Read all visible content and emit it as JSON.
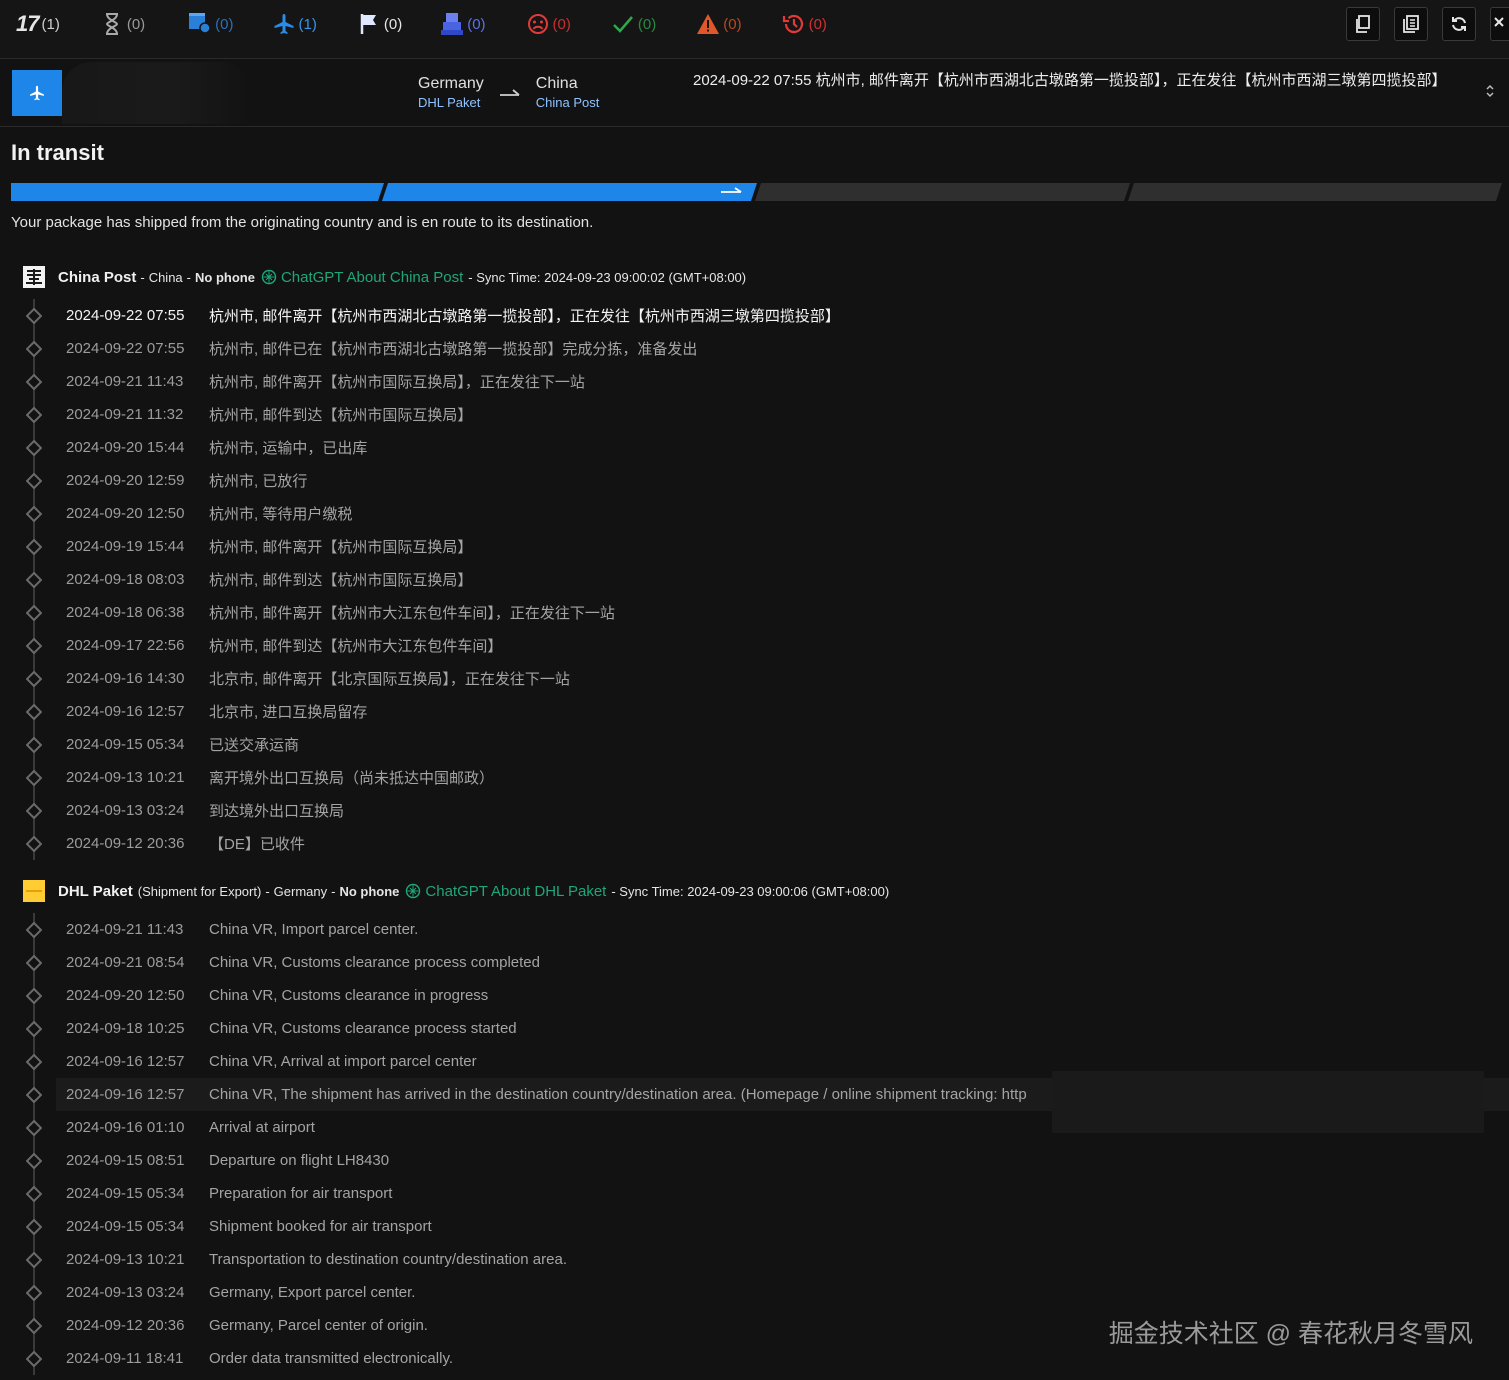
{
  "filters": [
    {
      "name": "all-filter",
      "icon": "brand-17-logo",
      "count": "(1)"
    },
    {
      "name": "pending-filter",
      "icon": "hourglass-icon",
      "count": "(0)"
    },
    {
      "name": "info-received-filter",
      "icon": "truck-box-icon",
      "count": "(0)"
    },
    {
      "name": "in-transit-filter",
      "icon": "plane-icon",
      "count": "(1)"
    },
    {
      "name": "pickup-filter",
      "icon": "flag-icon",
      "count": "(0)"
    },
    {
      "name": "undelivered-filter",
      "icon": "package-stack-icon",
      "count": "(0)"
    },
    {
      "name": "failed-filter",
      "icon": "sad-face-icon",
      "count": "(0)"
    },
    {
      "name": "delivered-filter",
      "icon": "check-icon",
      "count": "(0)"
    },
    {
      "name": "alert-filter",
      "icon": "warning-icon",
      "count": "(0)"
    },
    {
      "name": "expired-filter",
      "icon": "history-icon",
      "count": "(0)"
    }
  ],
  "brand_text": "17",
  "summary": {
    "origin_country": "Germany",
    "origin_carrier": "DHL Paket",
    "dest_country": "China",
    "dest_carrier": "China Post",
    "last_event": "2024-09-22 07:55  杭州市, 邮件离开【杭州市西湖北古墩路第一揽投部】，正在发往【杭州市西湖三墩第四揽投部】"
  },
  "status": {
    "title": "In transit",
    "description": "Your package has shipped from the originating country and is en route to its destination.",
    "progress_steps_done": 2,
    "progress_steps_total": 4
  },
  "colors": {
    "accent": "#1d86e8",
    "gpt": "#1fa67a",
    "link": "#8fc3ff"
  },
  "china_post": {
    "name": "China Post",
    "country": "China",
    "phone": "No phone",
    "gpt_label": "ChatGPT About China Post",
    "sync": "- Sync Time: 2024-09-23 09:00:02 (GMT+08:00)",
    "events": [
      {
        "time": "2024-09-22 07:55",
        "desc": "杭州市, 邮件离开【杭州市西湖北古墩路第一揽投部】，正在发往【杭州市西湖三墩第四揽投部】"
      },
      {
        "time": "2024-09-22 07:55",
        "desc": "杭州市, 邮件已在【杭州市西湖北古墩路第一揽投部】完成分拣，准备发出"
      },
      {
        "time": "2024-09-21 11:43",
        "desc": "杭州市, 邮件离开【杭州市国际互换局】，正在发往下一站"
      },
      {
        "time": "2024-09-21 11:32",
        "desc": "杭州市, 邮件到达【杭州市国际互换局】"
      },
      {
        "time": "2024-09-20 15:44",
        "desc": "杭州市, 运输中，已出库"
      },
      {
        "time": "2024-09-20 12:59",
        "desc": "杭州市, 已放行"
      },
      {
        "time": "2024-09-20 12:50",
        "desc": "杭州市, 等待用户缴税"
      },
      {
        "time": "2024-09-19 15:44",
        "desc": "杭州市, 邮件离开【杭州市国际互换局】"
      },
      {
        "time": "2024-09-18 08:03",
        "desc": "杭州市, 邮件到达【杭州市国际互换局】"
      },
      {
        "time": "2024-09-18 06:38",
        "desc": "杭州市, 邮件离开【杭州市大江东包件车间】，正在发往下一站"
      },
      {
        "time": "2024-09-17 22:56",
        "desc": "杭州市, 邮件到达【杭州市大江东包件车间】"
      },
      {
        "time": "2024-09-16 14:30",
        "desc": "北京市, 邮件离开【北京国际互换局】，正在发往下一站"
      },
      {
        "time": "2024-09-16 12:57",
        "desc": "北京市, 进口互换局留存"
      },
      {
        "time": "2024-09-15 05:34",
        "desc": "已送交承运商"
      },
      {
        "time": "2024-09-13 10:21",
        "desc": "离开境外出口互换局（尚未抵达中国邮政）"
      },
      {
        "time": "2024-09-13 03:24",
        "desc": "到达境外出口互换局"
      },
      {
        "time": "2024-09-12 20:36",
        "desc": "【DE】已收件"
      }
    ]
  },
  "dhl": {
    "name": "DHL Paket",
    "note": "(Shipment for Export)",
    "country": "Germany",
    "phone": "No phone",
    "gpt_label": "ChatGPT About DHL Paket",
    "sync": "- Sync Time: 2024-09-23 09:00:06 (GMT+08:00)",
    "events": [
      {
        "time": "2024-09-21 11:43",
        "desc": "China VR, Import parcel center."
      },
      {
        "time": "2024-09-21 08:54",
        "desc": "China VR, Customs clearance process completed"
      },
      {
        "time": "2024-09-20 12:50",
        "desc": "China VR, Customs clearance in progress"
      },
      {
        "time": "2024-09-18 10:25",
        "desc": "China VR, Customs clearance process started"
      },
      {
        "time": "2024-09-16 12:57",
        "desc": "China VR, Arrival at import parcel center"
      },
      {
        "time": "2024-09-16 12:57",
        "desc": "China VR, The shipment has arrived in the destination country/destination area. (Homepage / online shipment tracking: http"
      },
      {
        "time": "2024-09-16 01:10",
        "desc": "Arrival at airport"
      },
      {
        "time": "2024-09-15 08:51",
        "desc": "Departure on flight LH8430"
      },
      {
        "time": "2024-09-15 05:34",
        "desc": "Preparation for air transport"
      },
      {
        "time": "2024-09-15 05:34",
        "desc": "Shipment booked for air transport"
      },
      {
        "time": "2024-09-13 10:21",
        "desc": "Transportation to destination country/destination area."
      },
      {
        "time": "2024-09-13 03:24",
        "desc": "Germany, Export parcel center."
      },
      {
        "time": "2024-09-12 20:36",
        "desc": "Germany, Parcel center of origin."
      },
      {
        "time": "2024-09-11 18:41",
        "desc": "Order data transmitted electronically."
      }
    ]
  },
  "watermark": "掘金技术社区 @ 春花秋月冬雪风"
}
